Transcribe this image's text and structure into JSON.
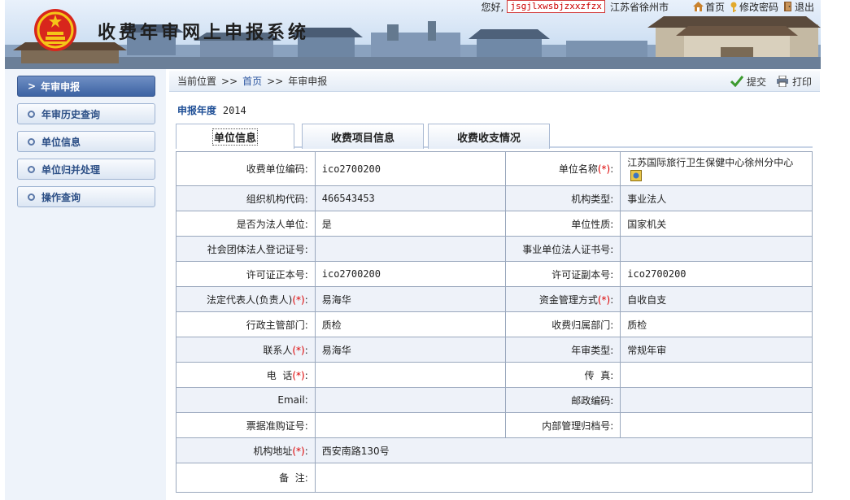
{
  "header": {
    "title": "收费年审网上申报系统",
    "greeting": "您好,",
    "username": "jsgjlxwsbjzxxzfzx",
    "city": "江苏省徐州市",
    "links": {
      "home": "首页",
      "change_password": "修改密码",
      "logout": "退出"
    }
  },
  "sidebar": {
    "items": [
      {
        "label": "年审申报",
        "active": true
      },
      {
        "label": "年审历史查询",
        "active": false
      },
      {
        "label": "单位信息",
        "active": false
      },
      {
        "label": "单位归并处理",
        "active": false
      },
      {
        "label": "操作查询",
        "active": false
      }
    ]
  },
  "breadcrumb": {
    "prefix": "当前位置",
    "separator": ">>",
    "home": "首页",
    "current": "年审申报",
    "submit": "提交",
    "print": "打印"
  },
  "year": {
    "label": "申报年度",
    "value": "2014"
  },
  "tabs": [
    {
      "label": "单位信息",
      "active": true
    },
    {
      "label": "收费项目信息",
      "active": false
    },
    {
      "label": "收费收支情况",
      "active": false
    }
  ],
  "form": {
    "r1": {
      "l1": "收费单位编码:",
      "v1": "ico2700200",
      "l2": "单位名称",
      "v2": "江苏国际旅行卫生保健中心徐州分中心"
    },
    "r2": {
      "l1": "组织机构代码:",
      "v1": "466543453",
      "l2": "机构类型:",
      "v2": "事业法人"
    },
    "r3": {
      "l1": "是否为法人单位:",
      "v1": "是",
      "l2": "单位性质:",
      "v2": "国家机关"
    },
    "r4": {
      "l1": "社会团体法人登记证号:",
      "v1": "",
      "l2": "事业单位法人证书号:",
      "v2": ""
    },
    "r5": {
      "l1": "许可证正本号:",
      "v1": "ico2700200",
      "l2": "许可证副本号:",
      "v2": "ico2700200"
    },
    "r6": {
      "l1": "法定代表人(负责人)",
      "v1": "易海华",
      "l2": "资金管理方式",
      "v2": "自收自支"
    },
    "r7": {
      "l1": "行政主管部门:",
      "v1": "质检",
      "l2": "收费归属部门:",
      "v2": "质检"
    },
    "r8": {
      "l1": "联系人",
      "v1": "易海华",
      "l2": "年审类型:",
      "v2": "常规年审"
    },
    "r9": {
      "l1": "电  话",
      "v1": "",
      "l2": "传  真:",
      "v2": ""
    },
    "r10": {
      "l1": "Email:",
      "v1": "",
      "l2": "邮政编码:",
      "v2": ""
    },
    "r11": {
      "l1": "票据准购证号:",
      "v1": "",
      "l2": "内部管理归档号:",
      "v2": ""
    },
    "r12": {
      "l1": "机构地址",
      "v1": "西安南路130号"
    },
    "r13": {
      "l1": "备  注:",
      "v1": ""
    },
    "required_mark": "(*)",
    "colon": ":"
  }
}
